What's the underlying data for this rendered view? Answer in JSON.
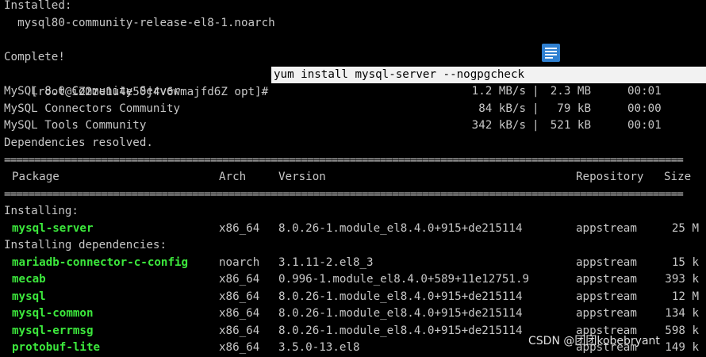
{
  "terminal": {
    "top_lines": {
      "installed_header": "Installed:",
      "installed_pkg": "  mysql80-community-release-el8-1.noarch",
      "complete": "Complete!"
    },
    "prompt": "[root@iZ2ze1u4e50j4v6wmajfd6Z opt]# ",
    "command": "yum install mysql-server --nogpgcheck",
    "repo_downloads": [
      {
        "name": "MySQL 8.0 Community Server",
        "speed": "1.2 MB/s",
        "size": "2.3 MB",
        "time": "00:01"
      },
      {
        "name": "MySQL Connectors Community",
        "speed": "84 kB/s",
        "size": "79 kB",
        "time": "00:00"
      },
      {
        "name": "MySQL Tools Community",
        "speed": "342 kB/s",
        "size": "521 kB",
        "time": "00:01"
      }
    ],
    "dependencies_resolved": "Dependencies resolved.",
    "separator": "================================================================================================================",
    "table_headers": {
      "package": "Package",
      "arch": "Arch",
      "version": "Version",
      "repository": "Repository",
      "size": "Size"
    },
    "installing_label": "Installing:",
    "installing": [
      {
        "name": "mysql-server",
        "arch": "x86_64",
        "version": "8.0.26-1.module_el8.4.0+915+de215114",
        "repo": "appstream",
        "size": "25 M"
      }
    ],
    "deps_label": "Installing dependencies:",
    "dependencies": [
      {
        "name": "mariadb-connector-c-config",
        "arch": "noarch",
        "version": "3.1.11-2.el8_3",
        "repo": "appstream",
        "size": "15 k"
      },
      {
        "name": "mecab",
        "arch": "x86_64",
        "version": "0.996-1.module_el8.4.0+589+11e12751.9",
        "repo": "appstream",
        "size": "393 k"
      },
      {
        "name": "mysql",
        "arch": "x86_64",
        "version": "8.0.26-1.module_el8.4.0+915+de215114",
        "repo": "appstream",
        "size": "12 M"
      },
      {
        "name": "mysql-common",
        "arch": "x86_64",
        "version": "8.0.26-1.module_el8.4.0+915+de215114",
        "repo": "appstream",
        "size": "134 k"
      },
      {
        "name": "mysql-errmsg",
        "arch": "x86_64",
        "version": "8.0.26-1.module_el8.4.0+915+de215114",
        "repo": "appstream",
        "size": "598 k"
      },
      {
        "name": "protobuf-lite",
        "arch": "x86_64",
        "version": "3.5.0-13.el8",
        "repo": "appstream",
        "size": "149 k"
      }
    ]
  },
  "watermark": "CSDN @团团kobebryant",
  "icons": {
    "floating": "document-icon"
  },
  "colors": {
    "background": "#000000",
    "text": "#c7c7c7",
    "package_name": "#3ce83c",
    "command_highlight": "#f2f2f2"
  }
}
